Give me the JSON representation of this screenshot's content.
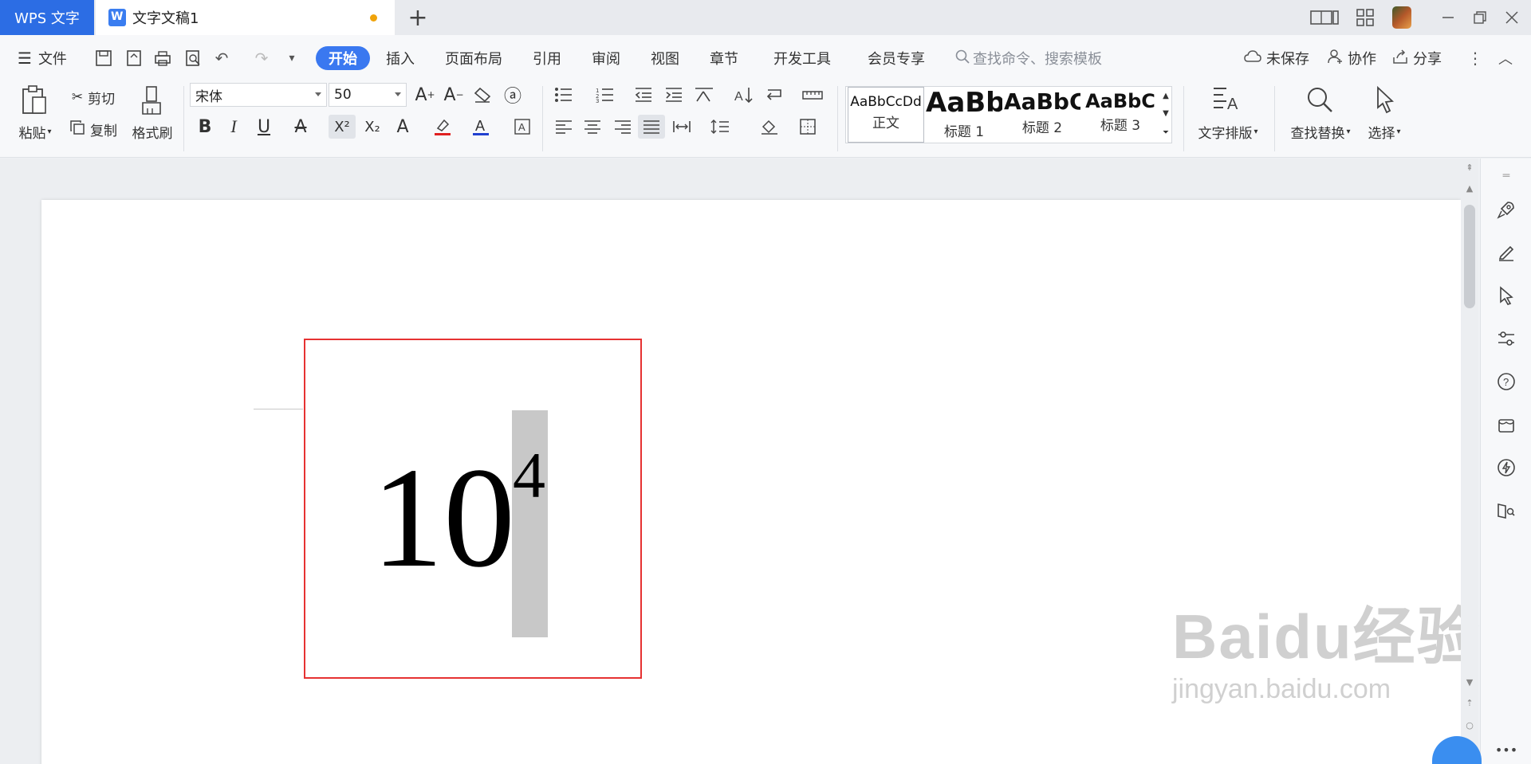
{
  "titlebar": {
    "app_name": "WPS 文字",
    "document_tab": "文字文稿1",
    "new_tab_symbol": "+"
  },
  "menubar": {
    "file": "文件",
    "tabs": [
      "开始",
      "插入",
      "页面布局",
      "引用",
      "审阅",
      "视图",
      "章节",
      "开发工具",
      "会员专享"
    ],
    "active_tab": "开始",
    "search_placeholder": "查找命令、搜索模板",
    "unsaved": "未保存",
    "collaborate": "协作",
    "share": "分享"
  },
  "ribbon": {
    "paste": "粘贴",
    "cut": "剪切",
    "copy": "复制",
    "format_painter": "格式刷",
    "font_name": "宋体",
    "font_size": "50",
    "styles": [
      {
        "sample": "AaBbCcDd",
        "name": "正文"
      },
      {
        "sample": "AaBb",
        "name": "标题 1"
      },
      {
        "sample": "AaBbC",
        "name": "标题 2"
      },
      {
        "sample": "AaBbC",
        "name": "标题 3"
      }
    ],
    "text_layout": "文字排版",
    "find_replace": "查找替换",
    "select": "选择"
  },
  "document": {
    "base_text": "10",
    "superscript_text": "4"
  },
  "watermark": {
    "brand": "Baidu经验",
    "url": "jingyan.baidu.com"
  }
}
